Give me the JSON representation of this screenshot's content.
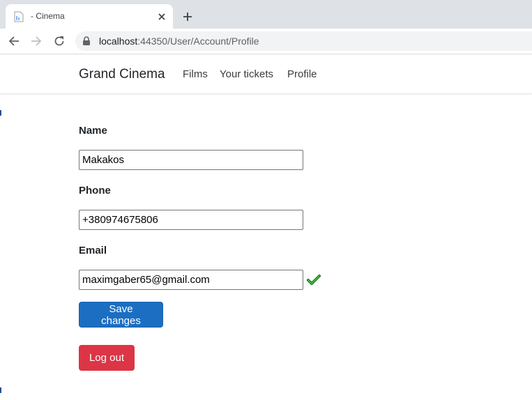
{
  "browser": {
    "tab_title": "- Cinema",
    "url_host": "localhost",
    "url_rest": ":44350/User/Account/Profile"
  },
  "navbar": {
    "brand": "Grand Cinema",
    "links": [
      "Films",
      "Your tickets",
      "Profile"
    ]
  },
  "form": {
    "name_label": "Name",
    "name_value": "Makakos",
    "phone_label": "Phone",
    "phone_value": "+380974675806",
    "email_label": "Email",
    "email_value": "maximgaber65@gmail.com",
    "email_valid": true,
    "save_button": "Save changes",
    "logout_button": "Log out"
  },
  "colors": {
    "primary": "#1b6ec2",
    "danger": "#dc3545",
    "valid_check": "#2e9e2e"
  },
  "icons": {
    "tab": "document-favicon-icon",
    "close": "close-icon",
    "new_tab": "plus-icon",
    "back": "arrow-left-icon",
    "forward": "arrow-right-icon",
    "reload": "reload-icon",
    "security": "lock-icon",
    "valid": "checkmark-icon"
  }
}
